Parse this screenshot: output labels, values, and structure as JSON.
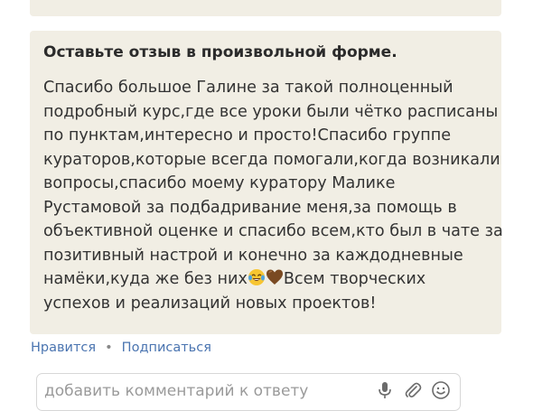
{
  "review": {
    "title": "Оставьте отзыв в произвольной форме.",
    "lines": [
      "Спасибо большое Галине за такой полноценный",
      "подробный курс,где все уроки были чётко расписаны",
      "по пунктам,интересно и просто!Спасибо группе",
      "кураторов,которые всегда помогали,когда возникали",
      "вопросы,спасибо моему куратору Малике",
      "Рустамовой за подбадривание меня,за помощь в",
      "объективной оценке и спасибо всем,кто был в чате за",
      "позитивный настрой и конечно за каждодневные"
    ],
    "line9_before": "намёки,куда же без них",
    "line9_after": "Всем творческих",
    "line10": "успехов и реализаций новых проектов!",
    "emojis": [
      "laughing-tears-emoji",
      "brown-heart-emoji"
    ]
  },
  "actions": {
    "like": "Нравится",
    "separator": "•",
    "subscribe": "Подписаться"
  },
  "comment": {
    "placeholder": "добавить комментарий к ответу"
  },
  "icons": [
    "mic-icon",
    "paperclip-icon",
    "smiley-icon"
  ],
  "colors": {
    "card_background": "#f1eee4",
    "link": "#4a74b0"
  }
}
